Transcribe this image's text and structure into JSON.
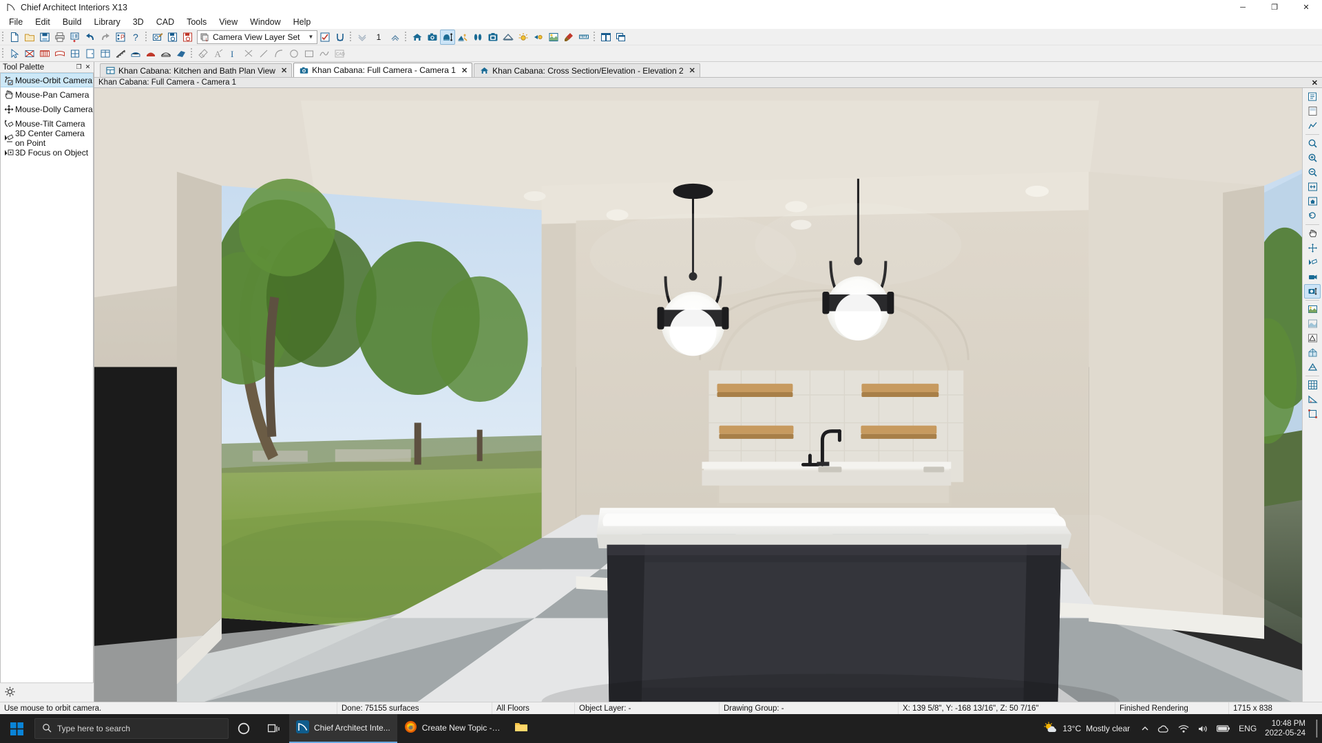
{
  "window": {
    "title": "Chief Architect Interiors X13",
    "app_icon": "chief-architect-icon",
    "controls": {
      "minimize": "─",
      "maximize": "❐",
      "close": "✕"
    }
  },
  "menubar": {
    "items": [
      "File",
      "Edit",
      "Build",
      "Library",
      "3D",
      "CAD",
      "Tools",
      "View",
      "Window",
      "Help"
    ]
  },
  "toolbar_main": {
    "layer_set": {
      "label": "Camera View Layer Set",
      "icon": "layer-set-icon",
      "arrow": "▼"
    },
    "floor_number": "1",
    "groups": [
      {
        "buttons": [
          {
            "name": "new-plan-button",
            "icon": "new-document-icon",
            "tip": "New Plan"
          },
          {
            "name": "open-plan-button",
            "icon": "open-folder-icon",
            "tip": "Open Plan"
          },
          {
            "name": "save-button",
            "icon": "save-disk-icon",
            "tip": "Save Plan"
          },
          {
            "name": "print-button",
            "icon": "printer-icon",
            "tip": "Print"
          },
          {
            "name": "print-preview-button",
            "icon": "print-preview-icon",
            "tip": "Print Preview"
          },
          {
            "name": "undo-button",
            "icon": "undo-arrow-icon",
            "tip": "Undo"
          },
          {
            "name": "redo-button",
            "icon": "redo-arrow-icon",
            "tip": "Redo"
          },
          {
            "name": "preferences-button",
            "icon": "preferences-icon",
            "tip": "Preferences"
          },
          {
            "name": "help-button",
            "icon": "question-mark-icon",
            "tip": "Help"
          }
        ]
      },
      {
        "buttons": [
          {
            "name": "edit-active-view-button",
            "icon": "camera-edit-icon",
            "tip": "Edit Active View"
          },
          {
            "name": "save-active-layer-set-button",
            "icon": "save-layer-set-icon",
            "tip": "Save Layer Set"
          },
          {
            "name": "delete-layer-set-button",
            "icon": "delete-layer-set-icon",
            "tip": "Delete Layer Set"
          }
        ]
      },
      {
        "buttons": [
          {
            "name": "display-options-button",
            "icon": "checklist-icon",
            "tip": "Layer Display Options"
          },
          {
            "name": "wall-tool-button",
            "icon": "u-shape-icon",
            "tip": "Toggle"
          }
        ]
      },
      {
        "buttons": [
          {
            "name": "down-one-floor-button",
            "icon": "chevron-double-down-icon",
            "tip": "Down One Floor"
          },
          {
            "name": "up-one-floor-button",
            "icon": "chevron-up-roof-icon",
            "tip": "Up One Floor"
          }
        ]
      },
      {
        "buttons": [
          {
            "name": "full-camera-button",
            "icon": "house-camera-icon",
            "tip": "Full Camera"
          },
          {
            "name": "perspective-camera-button",
            "icon": "camera-icon",
            "tip": "Camera"
          },
          {
            "name": "elevation-camera-button",
            "icon": "elevation-camera-icon",
            "tip": "Cross Section / Elevation",
            "active": true
          },
          {
            "name": "material-painter-button",
            "icon": "paint-tools-icon",
            "tip": "Material Painter"
          },
          {
            "name": "walkthrough-button",
            "icon": "footsteps-icon",
            "tip": "Walkthrough"
          },
          {
            "name": "picture-file-button",
            "icon": "picture-frame-icon",
            "tip": "Export Picture"
          },
          {
            "name": "roof-button",
            "icon": "roof-icon",
            "tip": "Roof"
          },
          {
            "name": "sun-angle-button",
            "icon": "sun-icon",
            "tip": "Adjust Sunlight"
          },
          {
            "name": "light-button",
            "icon": "spot-light-icon",
            "tip": "Lighting"
          },
          {
            "name": "rendering-technique-button",
            "icon": "render-technique-icon",
            "tip": "Rendering Techniques"
          },
          {
            "name": "paintbrush-button",
            "icon": "paintbrush-icon",
            "tip": "Material Painter"
          },
          {
            "name": "ruler-button",
            "icon": "ruler-icon",
            "tip": "Measure"
          }
        ]
      },
      {
        "buttons": [
          {
            "name": "window-tile-button",
            "icon": "tile-windows-icon",
            "tip": "Tile Windows"
          },
          {
            "name": "window-cascade-button",
            "icon": "cascade-windows-icon",
            "tip": "Cascade Windows"
          }
        ]
      }
    ]
  },
  "toolbar_second": {
    "groups": [
      {
        "buttons": [
          {
            "name": "select-objects-button",
            "icon": "arrow-cursor-icon",
            "tip": "Select Objects"
          },
          {
            "name": "room-tool-button",
            "icon": "room-icon",
            "tip": "Room"
          },
          {
            "name": "wall-tool-button",
            "icon": "wall-icon",
            "tip": "Walls"
          },
          {
            "name": "railing-tool-button",
            "icon": "railing-icon",
            "tip": "Railing"
          },
          {
            "name": "window-tool-button",
            "icon": "window-icon",
            "tip": "Window"
          },
          {
            "name": "door-tool-button",
            "icon": "door-icon",
            "tip": "Door"
          },
          {
            "name": "cabinet-tool-button",
            "icon": "cabinet-icon",
            "tip": "Cabinet"
          },
          {
            "name": "stairs-tool-button",
            "icon": "stairs-icon",
            "tip": "Stairs"
          },
          {
            "name": "fireplace-tool-button",
            "icon": "fireplace-icon",
            "tip": "Fireplace"
          },
          {
            "name": "furniture-tool-button",
            "icon": "furniture-icon",
            "tip": "Furniture"
          },
          {
            "name": "millwork-tool-button",
            "icon": "millwork-icon",
            "tip": "Millwork"
          },
          {
            "name": "material-region-button",
            "icon": "material-region-icon",
            "tip": "Material Region"
          }
        ]
      },
      {
        "buttons": [
          {
            "name": "dimension-tool-button",
            "icon": "dimension-icon",
            "tip": "Dimensions"
          },
          {
            "name": "text-tool-button",
            "icon": "text-a-icon",
            "tip": "Text"
          },
          {
            "name": "text-line-button",
            "icon": "text-cursor-icon",
            "tip": "Text Line with Arrow"
          },
          {
            "name": "cad-line-button",
            "icon": "cad-x-icon",
            "tip": "CAD Line"
          },
          {
            "name": "line-tool-button",
            "icon": "line-icon",
            "tip": "Line"
          },
          {
            "name": "arc-tool-button",
            "icon": "arc-icon",
            "tip": "Arc"
          },
          {
            "name": "circle-tool-button",
            "icon": "circle-icon",
            "tip": "Circle"
          },
          {
            "name": "rectangle-tool-button",
            "icon": "rectangle-icon",
            "tip": "Rectangle"
          },
          {
            "name": "spline-tool-button",
            "icon": "spline-icon",
            "tip": "Spline"
          },
          {
            "name": "cad-block-button",
            "icon": "cad-block-icon",
            "tip": "CAD Block"
          }
        ]
      }
    ]
  },
  "tool_palette": {
    "title": "Tool Palette",
    "float_button": "❐",
    "close_button": "✕",
    "settings_icon": "gear-icon",
    "items": [
      {
        "label": "Mouse-Orbit Camera",
        "icon": "mouse-orbit-camera-icon",
        "selected": true
      },
      {
        "label": "Mouse-Pan Camera",
        "icon": "mouse-pan-camera-icon",
        "selected": false
      },
      {
        "label": "Mouse-Dolly Camera",
        "icon": "mouse-dolly-camera-icon",
        "selected": false
      },
      {
        "label": "Mouse-Tilt Camera",
        "icon": "mouse-tilt-camera-icon",
        "selected": false
      },
      {
        "label": "3D Center Camera on Point",
        "icon": "center-camera-icon",
        "selected": false
      },
      {
        "label": "3D Focus on Object",
        "icon": "focus-object-icon",
        "selected": false
      }
    ]
  },
  "tabs": [
    {
      "label": "Khan Cabana: Kitchen and Bath Plan View",
      "icon": "plan-view-icon",
      "active": false,
      "close": "✕"
    },
    {
      "label": "Khan Cabana: Full Camera - Camera 1",
      "icon": "camera-icon",
      "active": true,
      "close": "✕"
    },
    {
      "label": "Khan Cabana: Cross Section/Elevation - Elevation 2",
      "icon": "elevation-icon",
      "active": false,
      "close": "✕"
    }
  ],
  "view_caption": {
    "title": "Khan Cabana: Full Camera - Camera 1",
    "close": "✕"
  },
  "right_toolbar": {
    "buttons": [
      {
        "name": "reference-display-button",
        "icon": "reference-display-icon"
      },
      {
        "name": "layout-page-button",
        "icon": "layout-page-icon"
      },
      {
        "name": "plot-lines-button",
        "icon": "plot-lines-icon"
      },
      {
        "name": "zoom-tool-button",
        "icon": "zoom-icon"
      },
      {
        "name": "zoom-in-button",
        "icon": "zoom-in-icon"
      },
      {
        "name": "zoom-out-button",
        "icon": "zoom-out-icon"
      },
      {
        "name": "fill-window-button",
        "icon": "fill-window-icon"
      },
      {
        "name": "fill-window-building-button",
        "icon": "fill-window-building-icon"
      },
      {
        "name": "undo-zoom-button",
        "icon": "undo-zoom-icon"
      },
      {
        "name": "pan-window-button",
        "icon": "pan-window-icon"
      },
      {
        "name": "scroll-window-button",
        "icon": "scroll-window-icon"
      },
      {
        "name": "view-direction-button",
        "icon": "view-direction-icon"
      },
      {
        "name": "move-camera-button",
        "icon": "move-camera-icon"
      },
      {
        "name": "camera-settings-button",
        "icon": "camera-settings-icon"
      },
      {
        "name": "final-view-button",
        "icon": "final-view-icon"
      },
      {
        "name": "watercolor-button",
        "icon": "watercolor-icon"
      },
      {
        "name": "line-drawing-button",
        "icon": "line-drawing-icon"
      },
      {
        "name": "glass-house-button",
        "icon": "glass-house-icon"
      },
      {
        "name": "vector-view-button",
        "icon": "vector-view-icon"
      },
      {
        "name": "grid-snaps-button",
        "icon": "grid-snaps-icon"
      },
      {
        "name": "angle-snaps-button",
        "icon": "angle-snaps-icon"
      },
      {
        "name": "object-snaps-button",
        "icon": "object-snaps-icon"
      }
    ]
  },
  "statusbar": {
    "hint": "Use mouse to orbit camera.",
    "progress": "Done:  75155 surfaces",
    "floors": "All Floors",
    "object_layer": "Object Layer: -",
    "drawing_group": "Drawing Group: -",
    "coordinates": "X: 139 5/8\", Y: -168 13/16\", Z: 50 7/16\"",
    "render_state": "Finished Rendering",
    "resolution": "1715 x 838"
  },
  "taskbar": {
    "start_icon": "windows-start-icon",
    "search_placeholder": "Type here to search",
    "search_icon": "search-icon",
    "cortana_icon": "cortana-circle-icon",
    "task_view_icon": "task-view-icon",
    "apps": [
      {
        "label": "Chief Architect Inte...",
        "icon": "chief-architect-icon",
        "active": true
      },
      {
        "label": "Create New Topic - ...",
        "icon": "firefox-icon",
        "active": false
      },
      {
        "label": "",
        "icon": "file-explorer-icon",
        "active": false
      }
    ],
    "weather": {
      "icon": "partly-sunny-icon",
      "temperature": "13°C",
      "condition": "Mostly clear"
    },
    "tray": {
      "chevron": "∧",
      "icons": [
        "onedrive-icon",
        "network-icon",
        "volume-icon",
        "battery-icon"
      ],
      "language": "ENG"
    },
    "clock": {
      "time": "10:48 PM",
      "date": "2022-05-24"
    },
    "notifications_icon": "notification-bar-icon"
  }
}
